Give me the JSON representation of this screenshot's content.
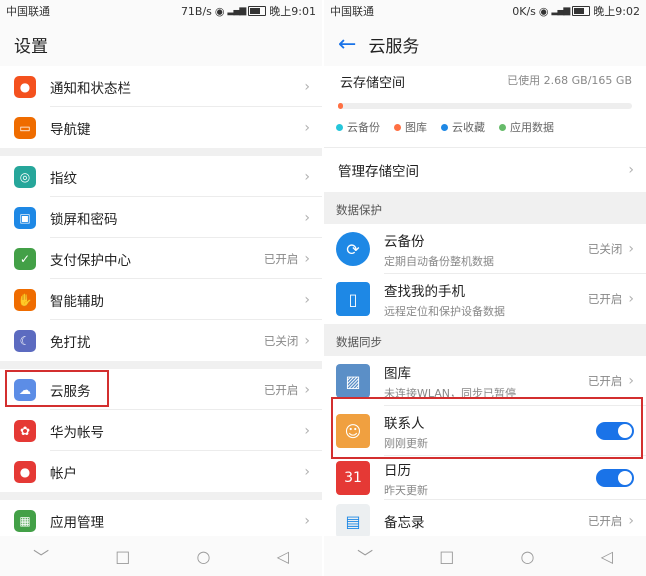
{
  "left": {
    "status": {
      "carrier": "中国联通",
      "speed": "71B/s",
      "time": "晚上9:01"
    },
    "title": "设置",
    "items": [
      {
        "label": "通知和状态栏",
        "status": "",
        "icon": "bell-icon",
        "color": "#f4511e"
      },
      {
        "label": "导航键",
        "status": "",
        "icon": "navigation-icon",
        "color": "#ef6c00"
      },
      {
        "label": "指纹",
        "status": "",
        "icon": "fingerprint-icon",
        "color": "#26a69a"
      },
      {
        "label": "锁屏和密码",
        "status": "",
        "icon": "lock-icon",
        "color": "#1e88e5"
      },
      {
        "label": "支付保护中心",
        "status": "已开启",
        "icon": "shield-icon",
        "color": "#43a047"
      },
      {
        "label": "智能辅助",
        "status": "",
        "icon": "hand-icon",
        "color": "#ef6c00"
      },
      {
        "label": "免打扰",
        "status": "已关闭",
        "icon": "moon-icon",
        "color": "#5c6bc0"
      },
      {
        "label": "云服务",
        "status": "已开启",
        "icon": "cloud-icon",
        "color": "#5c8de6"
      },
      {
        "label": "华为帐号",
        "status": "",
        "icon": "huawei-icon",
        "color": "#e53935"
      },
      {
        "label": "帐户",
        "status": "",
        "icon": "account-icon",
        "color": "#e53935"
      },
      {
        "label": "应用管理",
        "status": "",
        "icon": "apps-icon",
        "color": "#43a047"
      }
    ]
  },
  "right": {
    "status": {
      "carrier": "中国联通",
      "speed": "0K/s",
      "time": "晚上9:02"
    },
    "title": "云服务",
    "storage": {
      "title": "云存储空间",
      "used": "已使用 2.68 GB/165 GB",
      "fraction": 0.016,
      "legend": [
        {
          "label": "云备份",
          "color": "#26c6da"
        },
        {
          "label": "图库",
          "color": "#ff7043"
        },
        {
          "label": "云收藏",
          "color": "#1e88e5"
        },
        {
          "label": "应用数据",
          "color": "#66bb6a"
        }
      ]
    },
    "manage": "管理存储空间",
    "section_protect": "数据保护",
    "protect_items": [
      {
        "title": "云备份",
        "sub": "定期自动备份整机数据",
        "status": "已关闭"
      },
      {
        "title": "查找我的手机",
        "sub": "远程定位和保护设备数据",
        "status": "已开启"
      }
    ],
    "section_sync": "数据同步",
    "sync_items": [
      {
        "title": "图库",
        "sub": "未连接WLAN，同步已暂停",
        "status": "已开启"
      },
      {
        "title": "联系人",
        "sub": "刚刚更新",
        "status": ""
      },
      {
        "title": "日历",
        "sub": "昨天更新",
        "status": ""
      },
      {
        "title": "备忘录",
        "sub": "",
        "status": "已开启"
      }
    ],
    "calendar_day": "31"
  },
  "nav": {
    "back": "◁",
    "home": "○",
    "recents": "□",
    "hide": "﹀"
  }
}
